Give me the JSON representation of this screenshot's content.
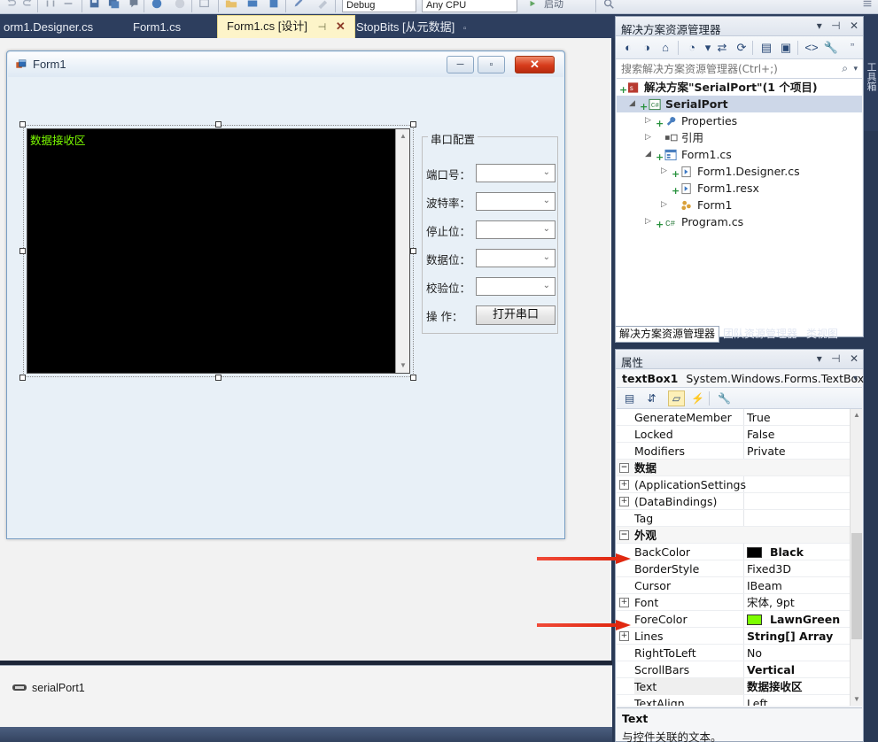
{
  "toolbar": {
    "config_combo": "Debug",
    "platform_combo": "Any CPU",
    "start_label": "启动"
  },
  "tabs": {
    "items": [
      {
        "label": "orm1.Designer.cs",
        "active": false
      },
      {
        "label": "Form1.cs",
        "active": false
      },
      {
        "label": "Form1.cs [设计]",
        "active": true,
        "pin": "⊣",
        "close": "✕"
      },
      {
        "label": "StopBits [从元数据]",
        "active": false,
        "meta": "▫"
      }
    ],
    "overflow": "«",
    "dropdown": "▾"
  },
  "designer": {
    "form": {
      "title": "Form1",
      "minimize": "─",
      "maximize": "▫",
      "close": "✕"
    },
    "textbox": {
      "text": "数据接收区",
      "scroll_up": "▲",
      "scroll_down": "▼"
    },
    "groupbox": {
      "title": "串口配置",
      "rows": [
        {
          "label": "端口号：",
          "type": "combo",
          "value": ""
        },
        {
          "label": "波特率：",
          "type": "combo",
          "value": ""
        },
        {
          "label": "停止位：",
          "type": "combo",
          "value": ""
        },
        {
          "label": "数据位：",
          "type": "combo",
          "value": ""
        },
        {
          "label": "校验位：",
          "type": "combo",
          "value": ""
        },
        {
          "label": "操  作：",
          "type": "button",
          "value": "打开串口"
        }
      ],
      "chevron": "⌄"
    }
  },
  "tray": {
    "component_name": "serialPort1"
  },
  "solution_explorer": {
    "title": "解决方案资源管理器",
    "window_buttons": {
      "dropdown": "▾",
      "pin": "⊣",
      "close": "✕"
    },
    "toolbar_icons": [
      "back-icon",
      "forward-icon",
      "home-icon",
      "pending-changes-icon",
      "sync-icon",
      "refresh-icon",
      "collapse-all-icon",
      "properties-window-icon",
      "show-all-files-icon",
      "view-code-icon"
    ],
    "search_placeholder": "搜索解决方案资源管理器(Ctrl+;)",
    "search_value": "",
    "tree": [
      {
        "label": "解决方案\"SerialPort\"(1 个项目)",
        "indent": 0,
        "expander": "",
        "plus": "+",
        "icon": "solution-icon",
        "bold": false,
        "selected": false
      },
      {
        "label": "SerialPort",
        "indent": 1,
        "expander": "◢",
        "plus": "+",
        "icon": "csproj-icon",
        "bold": true,
        "selected": true
      },
      {
        "label": "Properties",
        "indent": 2,
        "expander": "▷",
        "plus": "+",
        "icon": "wrench-icon",
        "bold": false,
        "selected": false
      },
      {
        "label": "引用",
        "indent": 2,
        "expander": "▷",
        "plus": "",
        "icon": "references-icon",
        "bold": false,
        "selected": false
      },
      {
        "label": "Form1.cs",
        "indent": 2,
        "expander": "◢",
        "plus": "+",
        "icon": "form-icon",
        "bold": false,
        "selected": false
      },
      {
        "label": "Form1.Designer.cs",
        "indent": 3,
        "expander": "▷",
        "plus": "+",
        "icon": "cs-file-icon",
        "bold": false,
        "selected": false
      },
      {
        "label": "Form1.resx",
        "indent": 3,
        "expander": "",
        "plus": "+",
        "icon": "cs-file-icon",
        "bold": false,
        "selected": false
      },
      {
        "label": "Form1",
        "indent": 3,
        "expander": "▷",
        "plus": "",
        "icon": "class-icon",
        "bold": false,
        "selected": false
      },
      {
        "label": "Program.cs",
        "indent": 2,
        "expander": "▷",
        "plus": "+",
        "icon": "csharp-icon",
        "bold": false,
        "selected": false
      }
    ]
  },
  "pane_tabs": [
    {
      "label": "解决方案资源管理器",
      "active": true
    },
    {
      "label": "团队资源管理器",
      "active": false
    },
    {
      "label": "类视图",
      "active": false
    }
  ],
  "properties": {
    "title": "属性",
    "window_buttons": {
      "dropdown": "▾",
      "pin": "⊣",
      "close": "✕"
    },
    "object_name": "textBox1",
    "object_type": "System.Windows.Forms.TextBox",
    "object_dropdown": "▾",
    "toolbar_icons": [
      "categorized-icon",
      "alphabetical-icon",
      "properties-icon",
      "events-icon",
      "property-pages-icon"
    ],
    "rows": [
      {
        "key": "GenerateMember",
        "value": "True",
        "kind": "prop",
        "bold": false,
        "expander": ""
      },
      {
        "key": "Locked",
        "value": "False",
        "kind": "prop",
        "bold": false,
        "expander": ""
      },
      {
        "key": "Modifiers",
        "value": "Private",
        "kind": "prop",
        "bold": false,
        "expander": ""
      },
      {
        "key": "数据",
        "value": "",
        "kind": "category",
        "bold": true,
        "expander": "−"
      },
      {
        "key": "(ApplicationSettings",
        "value": "",
        "kind": "prop",
        "bold": false,
        "expander": "+"
      },
      {
        "key": "(DataBindings)",
        "value": "",
        "kind": "prop",
        "bold": false,
        "expander": "+"
      },
      {
        "key": "Tag",
        "value": "",
        "kind": "prop",
        "bold": false,
        "expander": ""
      },
      {
        "key": "外观",
        "value": "",
        "kind": "category",
        "bold": true,
        "expander": "−"
      },
      {
        "key": "BackColor",
        "value": "Black",
        "kind": "prop",
        "bold": true,
        "expander": "",
        "swatch": "#000000"
      },
      {
        "key": "BorderStyle",
        "value": "Fixed3D",
        "kind": "prop",
        "bold": false,
        "expander": ""
      },
      {
        "key": "Cursor",
        "value": "IBeam",
        "kind": "prop",
        "bold": false,
        "expander": ""
      },
      {
        "key": "Font",
        "value": "宋体, 9pt",
        "kind": "prop",
        "bold": false,
        "expander": "+"
      },
      {
        "key": "ForeColor",
        "value": "LawnGreen",
        "kind": "prop",
        "bold": true,
        "expander": "",
        "swatch": "#7cfc00"
      },
      {
        "key": "Lines",
        "value": "String[] Array",
        "kind": "prop",
        "bold": true,
        "expander": "+"
      },
      {
        "key": "RightToLeft",
        "value": "No",
        "kind": "prop",
        "bold": false,
        "expander": ""
      },
      {
        "key": "ScrollBars",
        "value": "Vertical",
        "kind": "prop",
        "bold": true,
        "expander": ""
      },
      {
        "key": "Text",
        "value": "数据接收区",
        "kind": "prop",
        "bold": true,
        "expander": "",
        "selected": true
      },
      {
        "key": "TextAlign",
        "value": "Left",
        "kind": "prop",
        "bold": false,
        "expander": ""
      }
    ],
    "scroll_up": "▲",
    "scroll_down": "▼",
    "description_title": "Text",
    "description_body": "与控件关联的文本。"
  },
  "right_strip": {
    "label": "工具箱"
  },
  "annotations": {
    "colors": {
      "arrow": "#e02810"
    },
    "targets": [
      "BackColor",
      "ForeColor"
    ]
  }
}
